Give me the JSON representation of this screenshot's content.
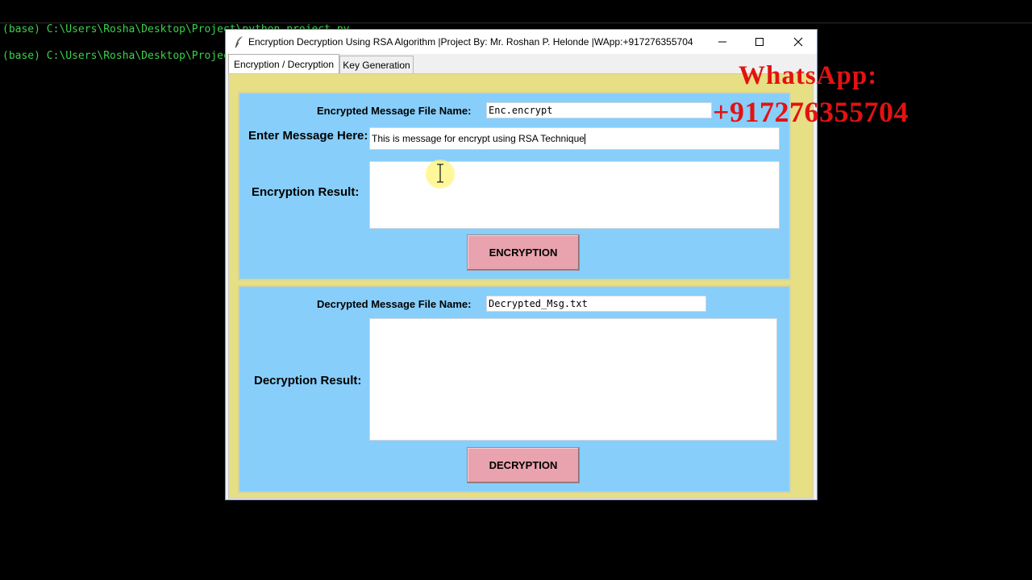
{
  "terminal": {
    "line1": "(base) C:\\Users\\Rosha\\Desktop\\Project\\python_project.py",
    "line2": "(base) C:\\Users\\Rosha\\Desktop\\Project>"
  },
  "overlay": {
    "whatsapp_label": "WhatsApp:",
    "phone": "+917276355704"
  },
  "window": {
    "title": "Encryption Decryption Using RSA Algorithm |Project By: Mr. Roshan P. Helonde |WApp:+917276355704",
    "icon": "feather-icon"
  },
  "tabs": [
    {
      "label": "Encryption / Decryption",
      "active": true
    },
    {
      "label": "Key Generation",
      "active": false
    }
  ],
  "encryption": {
    "file_label": "Encrypted Message File Name:",
    "file_value": "Enc.encrypt",
    "message_label": "Enter Message Here:",
    "message_value": "This is message for encrypt using RSA Technique",
    "result_label": "Encryption Result:",
    "button_label": "ENCRYPTION"
  },
  "decryption": {
    "file_label": "Decrypted Message File Name:",
    "file_value": "Decrypted_Msg.txt",
    "result_label": "Decryption Result:",
    "button_label": "DECRYPTION"
  },
  "colors": {
    "frame_bg": "#87cefa",
    "tab_body_bg": "#e7df83",
    "button_bg": "#e9a3ae",
    "overlay_red": "#e31212",
    "terminal_green": "#3ad14a"
  }
}
